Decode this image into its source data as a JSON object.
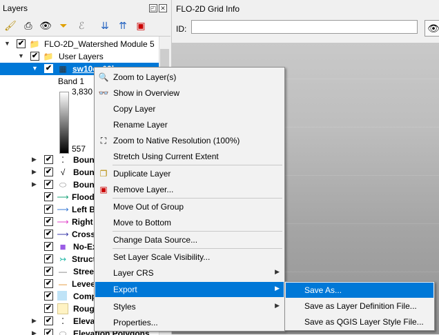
{
  "layers_panel": {
    "title": "Layers",
    "float_btn": "◰",
    "close_btn": "✕",
    "toolbar": [
      {
        "name": "style-manager-icon",
        "glyph": "🖌"
      },
      {
        "name": "add-group-icon",
        "glyph": "⎙"
      },
      {
        "name": "visibility-eye-icon",
        "glyph": "👁"
      },
      {
        "name": "filter-icon",
        "glyph": "⏷"
      },
      {
        "name": "filter-expression-icon",
        "glyph": "ℰ"
      },
      {
        "name": "expand-all-icon",
        "glyph": "⇊"
      },
      {
        "name": "collapse-all-icon",
        "glyph": "⇈"
      },
      {
        "name": "remove-layer-icon",
        "glyph": "▣"
      }
    ],
    "tree": [
      {
        "label": "FLO-2D_Watershed Module 5",
        "icon": "📁",
        "arrow": "▼",
        "checked": "✔"
      },
      {
        "label": "User Layers",
        "icon": "📁",
        "arrow": "▼",
        "checked": "✔"
      },
      {
        "label": "sw10cu03ha",
        "icon": "▦",
        "arrow": "▼",
        "checked": "✔"
      },
      {
        "label": "Bound",
        "icon": "⁚",
        "arrow": "▶",
        "checked": "✔"
      },
      {
        "label": "Bound",
        "icon": "√",
        "arrow": "▶",
        "checked": "✔"
      },
      {
        "label": "Bound",
        "icon": "⬭",
        "arrow": "▶",
        "checked": "✔"
      },
      {
        "label": "Flood",
        "icon": "⟶",
        "arrow": "",
        "checked": "✔"
      },
      {
        "label": "Left B",
        "icon": "⟶",
        "arrow": "",
        "checked": "✔"
      },
      {
        "label": "Right",
        "icon": "⟶",
        "arrow": "",
        "checked": "✔"
      },
      {
        "label": "Cross",
        "icon": "⟶",
        "arrow": "",
        "checked": "✔"
      },
      {
        "label": "No-Ex",
        "icon": "■",
        "arrow": "",
        "checked": "✔"
      },
      {
        "label": "Struct",
        "icon": "↣",
        "arrow": "",
        "checked": "✔"
      },
      {
        "label": "Stree",
        "icon": "—",
        "arrow": "",
        "checked": "✔"
      },
      {
        "label": "Levee",
        "icon": "—",
        "arrow": "",
        "checked": "✔"
      },
      {
        "label": "Comp",
        "icon": "□",
        "arrow": "",
        "checked": "✔"
      },
      {
        "label": "Roug",
        "icon": "□",
        "arrow": "",
        "checked": "✔"
      },
      {
        "label": "Eleva",
        "icon": "⁚",
        "arrow": "▶",
        "checked": "✔"
      },
      {
        "label": "Elevation Polygons",
        "icon": "⬭",
        "arrow": "▶",
        "checked": "✔"
      }
    ],
    "legend": {
      "band": "Band 1",
      "max": "3,830",
      "min": "557"
    },
    "colors": {
      "Flood": "#1aa37a",
      "Left B": "#3a7bd5",
      "Right": "#e040c8",
      "Cross": "#3a3aa8",
      "No-Ex": "#9b5de5",
      "Struct": "#22b8a8",
      "Stree": "#777777",
      "Levee": "#e08a1e",
      "Comp": "#bfe3f7",
      "Roug": "#fff3c4"
    }
  },
  "grid_panel": {
    "title": "FLO-2D Grid Info",
    "id_label": "ID:",
    "id_value": "",
    "eye_icon": "👁"
  },
  "context_menu": [
    {
      "label": "Zoom to Layer(s)",
      "icon": "🔍"
    },
    {
      "label": "Show in Overview",
      "icon": "👓"
    },
    {
      "label": "Copy Layer",
      "icon": ""
    },
    {
      "label": "Rename Layer",
      "icon": ""
    },
    {
      "label": "Zoom to Native Resolution (100%)",
      "icon": "⛶"
    },
    {
      "label": "Stretch Using Current Extent",
      "icon": ""
    },
    {
      "label": "Duplicate Layer",
      "icon": "❐"
    },
    {
      "label": "Remove Layer...",
      "icon": "▣"
    },
    {
      "label": "Move Out of Group",
      "icon": ""
    },
    {
      "label": "Move to Bottom",
      "icon": ""
    },
    {
      "label": "Change Data Source...",
      "icon": ""
    },
    {
      "label": "Set Layer Scale Visibility...",
      "icon": ""
    },
    {
      "label": "Layer CRS",
      "icon": "",
      "submenu": "▶"
    },
    {
      "label": "Export",
      "icon": "",
      "submenu": "▶"
    },
    {
      "label": "Styles",
      "icon": "",
      "submenu": "▶"
    },
    {
      "label": "Properties...",
      "icon": ""
    }
  ],
  "export_submenu": [
    {
      "label": "Save As..."
    },
    {
      "label": "Save as Layer Definition File..."
    },
    {
      "label": "Save as QGIS Layer Style File..."
    }
  ]
}
